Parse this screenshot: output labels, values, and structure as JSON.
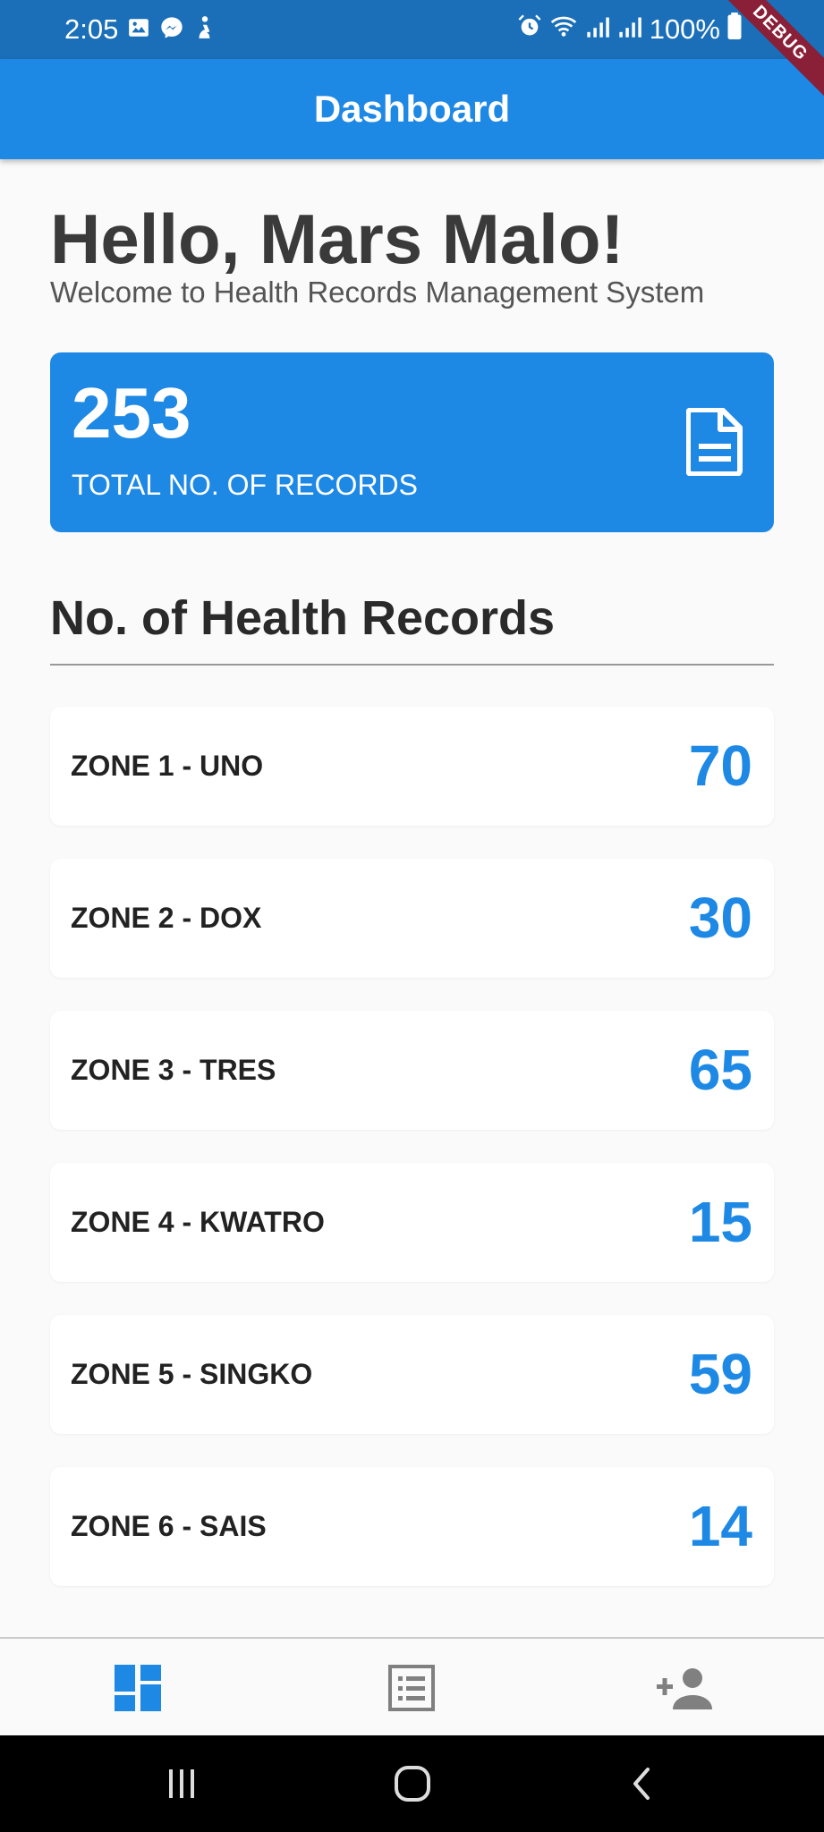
{
  "status_bar": {
    "time": "2:05",
    "battery": "100%",
    "left_icons": [
      "gallery-icon",
      "messenger-icon",
      "accessibility-icon"
    ],
    "right_icons": [
      "alarm-icon",
      "wifi-icon",
      "signal-icon",
      "signal-icon",
      "battery-icon"
    ],
    "debug_banner": "DEBUG"
  },
  "app_bar": {
    "title": "Dashboard"
  },
  "greeting": {
    "title": "Hello, Mars Malo!",
    "subtitle": "Welcome to Health Records Management System"
  },
  "total_card": {
    "value": "253",
    "label": "TOTAL NO. OF RECORDS",
    "icon": "document-icon"
  },
  "section": {
    "title": "No. of Health Records"
  },
  "zones": [
    {
      "name": "ZONE 1 - UNO",
      "count": "70"
    },
    {
      "name": "ZONE 2 - DOX",
      "count": "30"
    },
    {
      "name": "ZONE 3 - TRES",
      "count": "65"
    },
    {
      "name": "ZONE 4 - KWATRO",
      "count": "15"
    },
    {
      "name": "ZONE 5 - SINGKO",
      "count": "59"
    },
    {
      "name": "ZONE 6 - SAIS",
      "count": "14"
    }
  ],
  "bottom_nav": {
    "items": [
      {
        "icon": "dashboard-icon",
        "active": true
      },
      {
        "icon": "list-icon",
        "active": false
      },
      {
        "icon": "add-person-icon",
        "active": false
      }
    ]
  },
  "colors": {
    "primary": "#1e88e5",
    "status_bar": "#1a6fb8",
    "inactive_icon": "#808080"
  }
}
